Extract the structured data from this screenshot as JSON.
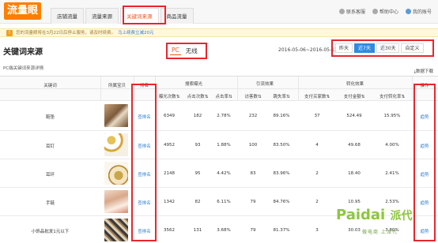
{
  "header": {
    "logo": "流量眼",
    "tabs": [
      {
        "label": "店铺流量",
        "active": false
      },
      {
        "label": "流量来源",
        "active": false
      },
      {
        "label": "关键词来源",
        "active": true
      },
      {
        "label": "商品流量",
        "active": false
      }
    ],
    "links": [
      "联系客服",
      "帮助中心",
      "我的账号"
    ]
  },
  "notice": {
    "text": "您的流量眼将在3月22日后停止服务，请及时续费。",
    "link": "马上续费立减20元"
  },
  "page": {
    "title": "关键词来源",
    "segment": [
      "PC",
      "无线"
    ],
    "date_range": "2016-05-06~2016-05-12",
    "range_buttons": [
      {
        "label": "昨天",
        "active": false
      },
      {
        "label": "近7天",
        "active": true
      },
      {
        "label": "近30天",
        "active": false
      },
      {
        "label": "自定义",
        "active": false
      }
    ],
    "subline": "PC端关键词来源详情",
    "download": "数据下载"
  },
  "table": {
    "group_headers": {
      "search": "搜索曝光",
      "traffic": "引流效果",
      "conversion": "转化效果"
    },
    "headers": {
      "keyword": "关键词",
      "item": "所属宝贝",
      "rank": "排名",
      "impressions": "曝光次数",
      "clicks": "点击次数",
      "ctr": "点击率",
      "visitors": "访客数",
      "bounce": "跳失率",
      "buyers": "支付买家数",
      "amount": "支付金额",
      "cvr": "支付转化率",
      "action": "操作"
    },
    "rows": [
      {
        "keyword": "鞋垫",
        "rank": "查排名",
        "impressions": "6349",
        "clicks": "182",
        "ctr": "2.78%",
        "visitors": "232",
        "bounce": "89.16%",
        "buyers": "37",
        "amount": "524.49",
        "cvr": "15.95%",
        "action": "趋势"
      },
      {
        "keyword": "耳钉",
        "rank": "查排名",
        "impressions": "4952",
        "clicks": "93",
        "ctr": "1.88%",
        "visitors": "100",
        "bounce": "83.50%",
        "buyers": "4",
        "amount": "49.68",
        "cvr": "4.00%",
        "action": "趋势"
      },
      {
        "keyword": "耳环",
        "rank": "查排名",
        "impressions": "2148",
        "clicks": "95",
        "ctr": "4.42%",
        "visitors": "83",
        "bounce": "83.96%",
        "buyers": "2",
        "amount": "18.40",
        "cvr": "2.41%",
        "action": "趋势"
      },
      {
        "keyword": "手链",
        "rank": "查排名",
        "impressions": "1342",
        "clicks": "82",
        "ctr": "6.11%",
        "visitors": "79",
        "bounce": "84.76%",
        "buyers": "2",
        "amount": "10.95",
        "cvr": "2.53%",
        "action": "趋势"
      },
      {
        "keyword": "小饰品批发1元以下",
        "rank": "查排名",
        "impressions": "3562",
        "clicks": "131",
        "ctr": "3.68%",
        "visitors": "79",
        "bounce": "81.37%",
        "buyers": "3",
        "amount": "30.03",
        "cvr": "3.80%",
        "action": "趋势"
      }
    ]
  },
  "watermark": {
    "brand": "Paidai",
    "brand_cn": "派代",
    "sub": "做电商 上派代"
  },
  "colors": {
    "accent": "#f0541e",
    "highlight_box": "#e8262d",
    "link": "#2f7fd4",
    "active_button": "#2f8be0"
  }
}
